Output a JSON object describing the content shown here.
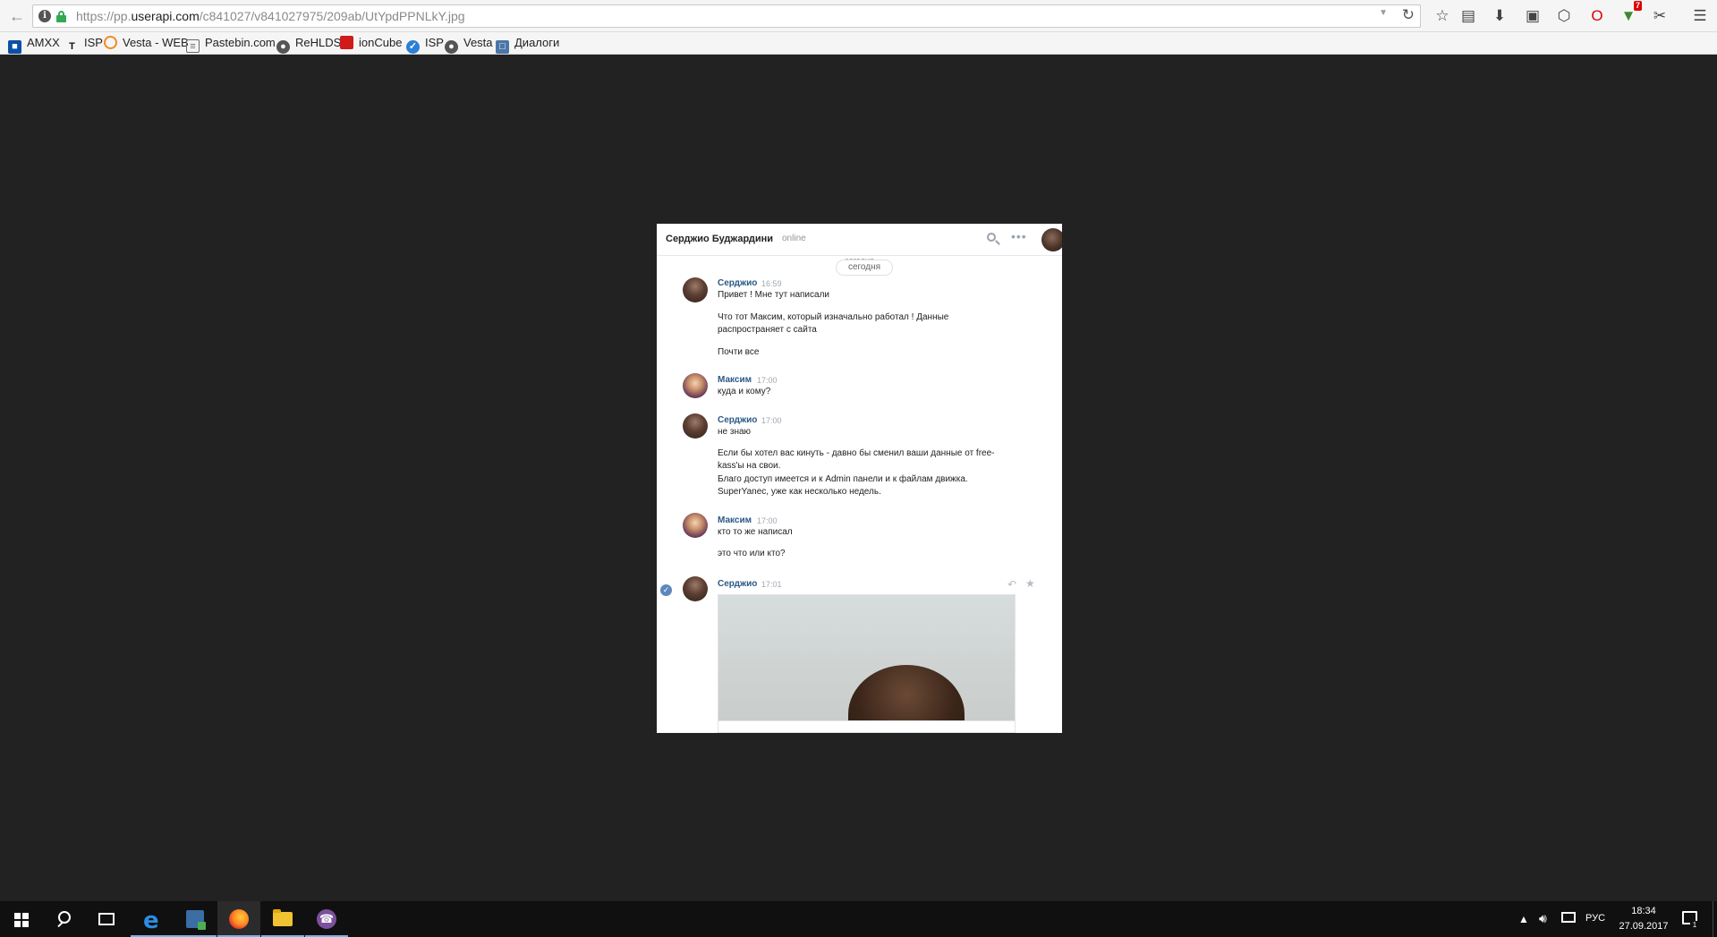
{
  "browser": {
    "url_prefix": "https://pp.",
    "url_host": "userapi.com",
    "url_path": "/c841027/v841027975/209ab/UtYpdPPNLkY.jpg",
    "toolbar_icons": [
      "back-arrow-icon",
      "bookmark-star-icon",
      "reading-list-icon",
      "download-icon",
      "screenshot-icon",
      "pocket-icon",
      "opera-icon",
      "extension-icon",
      "scissors-icon",
      "menu-icon"
    ],
    "extension_badge": "7"
  },
  "bookmarks": [
    {
      "label": "AMXX",
      "icon": "amxx-icon",
      "color": "#0b4fa8"
    },
    {
      "label": "ISP",
      "icon": "isp-icon",
      "color": "#111111"
    },
    {
      "label": "Vesta - WEB",
      "icon": "vesta-web-icon",
      "color": "#f08a24"
    },
    {
      "label": "Pastebin.com",
      "icon": "pastebin-icon",
      "color": "#6a6a6a"
    },
    {
      "label": "ReHLDS",
      "icon": "rehlds-icon",
      "color": "#555555"
    },
    {
      "label": "ionCube",
      "icon": "ioncube-icon",
      "color": "#d11a1a"
    },
    {
      "label": "ISP",
      "icon": "isp-check-icon",
      "color": "#2b7fd6"
    },
    {
      "label": "Vesta",
      "icon": "vesta-icon",
      "color": "#555555"
    },
    {
      "label": "Диалоги",
      "icon": "dialogs-icon",
      "color": "#4a76a8"
    }
  ],
  "chat": {
    "name": "Серджио Буджардини",
    "status": "online",
    "date_faded": "сегодня",
    "date": "сегодня",
    "messages": [
      {
        "author": "Серджио",
        "time": "16:59",
        "lines": [
          "Привет ! Мне тут написали",
          "Что тот Максим, который изначально работал ! Данные",
          "распространяет с сайта",
          "Почти все"
        ]
      },
      {
        "author": "Максим",
        "time": "17:00",
        "lines": [
          "куда и кому?"
        ]
      },
      {
        "author": "Серджио",
        "time": "17:00",
        "lines": [
          "не знаю",
          "Если бы хотел вас кинуть - давно бы сменил ваши данные от free-",
          "kass'ы на свои.",
          "Благо доступ имеется и к Admin панели и к файлам движка.",
          "SuperYanec, уже как несколько недель."
        ]
      },
      {
        "author": "Максим",
        "time": "17:00",
        "lines": [
          "кто то же написал",
          "это что или кто?"
        ]
      },
      {
        "author": "Серджио",
        "time": "17:01",
        "lines": []
      }
    ]
  },
  "taskbar": {
    "apps": [
      "windows-start-icon",
      "search-icon",
      "task-view-icon",
      "edge-icon",
      "store-icon",
      "firefox-icon",
      "file-explorer-icon",
      "viber-icon"
    ],
    "lang": "РУС",
    "time": "18:34",
    "date": "27.09.2017",
    "notifications": "1"
  }
}
